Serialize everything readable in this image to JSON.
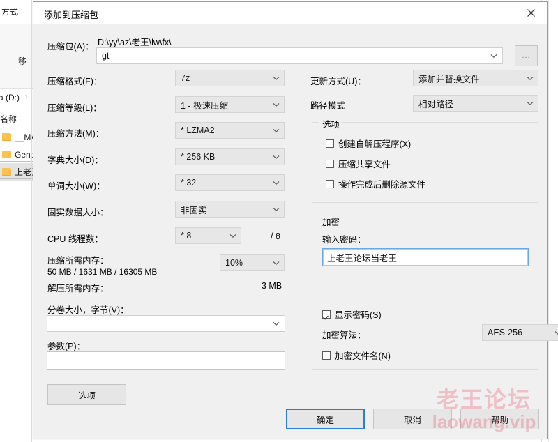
{
  "background": {
    "toolbar_label": "方式",
    "toolbar_label2": "移",
    "address_text": "a (D:)",
    "column_header": "名称",
    "rows": [
      {
        "name": "__MA",
        "selected": false
      },
      {
        "name": "Genta",
        "selected": false
      },
      {
        "name": "上老王",
        "selected": true
      }
    ]
  },
  "dialog": {
    "title": "添加到压缩包",
    "close_icon": "close-icon",
    "archive": {
      "label": "压缩包(A)：",
      "path_text": "D:\\yy\\az\\老王\\lw\\fx\\",
      "value": "gt",
      "browse_label": "..."
    },
    "left_fields": [
      {
        "label": "压缩格式(F)：",
        "value": "7z"
      },
      {
        "label": "压缩等级(L)：",
        "value": "1 - 极速压缩"
      },
      {
        "label": "压缩方法(M)：",
        "value": "*  LZMA2"
      },
      {
        "label": "字典大小(D)：",
        "value": "*  256 KB"
      },
      {
        "label": "单词大小(W)：",
        "value": "*  32"
      },
      {
        "label": "固实数据大小：",
        "value": "非固实"
      }
    ],
    "cpu": {
      "label": "CPU 线程数：",
      "value": "*  8",
      "total": "/ 8"
    },
    "memory": {
      "compress_label": "压缩所需内存：",
      "compress_value": "50 MB / 1631 MB / 16305 MB",
      "percent": "10%",
      "decompress_label": "解压所需内存：",
      "decompress_value": "3 MB"
    },
    "volume": {
      "label": "分卷大小，字节(V)：",
      "value": ""
    },
    "params": {
      "label": "参数(P)：",
      "value": ""
    },
    "update_mode": {
      "label": "更新方式(U)：",
      "value": "添加并替换文件"
    },
    "path_mode": {
      "label": "路径模式",
      "value": "相对路径"
    },
    "options_group": {
      "title": "选项",
      "items": [
        {
          "label": "创建自解压程序(X)",
          "checked": false
        },
        {
          "label": "压缩共享文件",
          "checked": false
        },
        {
          "label": "操作完成后删除源文件",
          "checked": false
        }
      ]
    },
    "encryption_group": {
      "title": "加密",
      "password_label": "输入密码：",
      "password_value": "上老王论坛当老王",
      "show_password": {
        "label": "显示密码(S)",
        "checked": true
      },
      "algorithm_label": "加密算法：",
      "algorithm_value": "AES-256",
      "encrypt_filenames": {
        "label": "加密文件名(N)",
        "checked": false
      }
    },
    "buttons": {
      "options": "选项",
      "ok": "确定",
      "cancel": "取消",
      "help": "帮助"
    }
  },
  "watermark": {
    "line1": "老王论坛",
    "line2": "laowang.vip",
    "color": "#e95468"
  }
}
